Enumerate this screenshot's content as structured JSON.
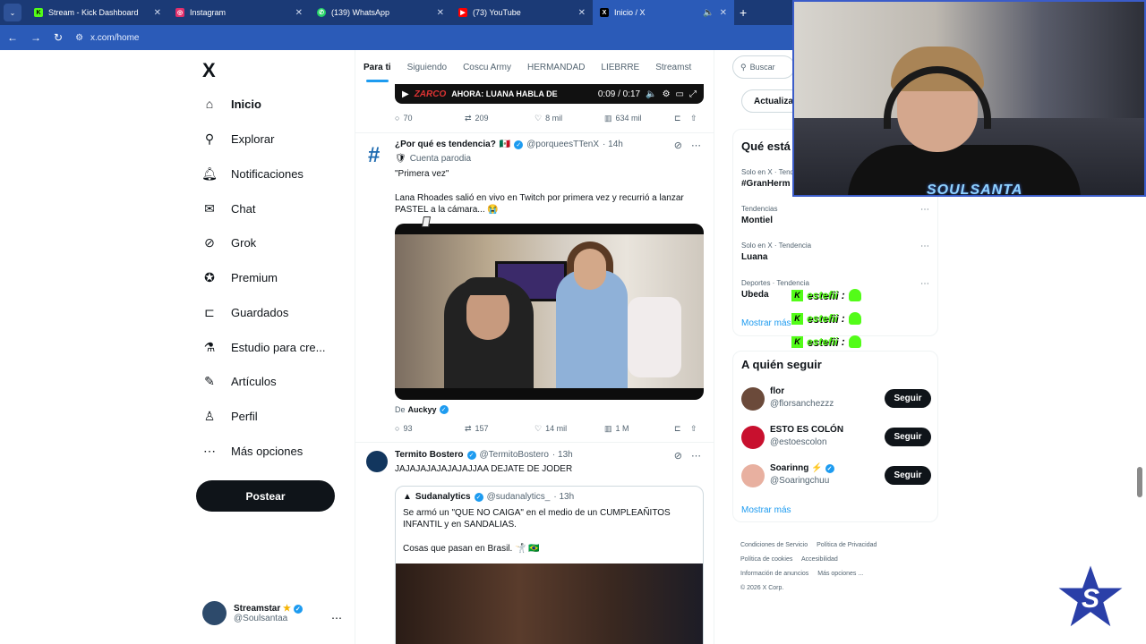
{
  "browser": {
    "tabs": [
      {
        "label": "Stream - Kick Dashboard",
        "icon": "kick-icon",
        "color": "#53fc18"
      },
      {
        "label": "Instagram",
        "icon": "instagram-icon",
        "color": "#e1306c"
      },
      {
        "label": "(139) WhatsApp",
        "icon": "whatsapp-icon",
        "color": "#25d366"
      },
      {
        "label": "(73) YouTube",
        "icon": "youtube-icon",
        "color": "#ff0000"
      },
      {
        "label": "Inicio / X",
        "icon": "x-icon",
        "color": "#000000",
        "active": true
      }
    ],
    "url": "x.com/home"
  },
  "nav": {
    "logo": "X",
    "items": [
      {
        "label": "Inicio",
        "icon": "home-icon",
        "active": true
      },
      {
        "label": "Explorar",
        "icon": "search-icon"
      },
      {
        "label": "Notificaciones",
        "icon": "bell-icon"
      },
      {
        "label": "Chat",
        "icon": "mail-icon"
      },
      {
        "label": "Grok",
        "icon": "grok-icon"
      },
      {
        "label": "Premium",
        "icon": "premium-icon"
      },
      {
        "label": "Guardados",
        "icon": "bookmark-icon"
      },
      {
        "label": "Estudio para cre...",
        "icon": "flask-icon"
      },
      {
        "label": "Artículos",
        "icon": "article-icon"
      },
      {
        "label": "Perfil",
        "icon": "person-icon"
      },
      {
        "label": "Más opciones",
        "icon": "more-circle-icon"
      }
    ],
    "post_label": "Postear",
    "profile": {
      "name": "Streamstar",
      "handle": "@Soulsantaa"
    }
  },
  "feed": {
    "tabs": [
      "Para ti",
      "Siguiendo",
      "Coscu Army",
      "HERMANDAD",
      "LIEBRRE",
      "Streamst"
    ],
    "video_strip": {
      "brand": "ZARCO",
      "title": "AHORA: LUANA HABLA DE",
      "time": "0:09 / 0:17"
    },
    "first_actions": {
      "replies": "70",
      "reposts": "209",
      "likes": "8 mil",
      "views": "634 mil"
    },
    "tweet2": {
      "name": "¿Por qué es tendencia?",
      "flag": "🇲🇽",
      "handle": "@porqueesTTenX",
      "time": "· 14h",
      "badge": "Cuenta parodia",
      "text1": "\"Primera vez\"",
      "text2": "Lana Rhoades salió en vivo en Twitch por primera vez y recurrió a lanzar PASTEL a la cámara... 😭",
      "credit_prefix": "De",
      "credit_name": "Auckyy",
      "replies": "93",
      "reposts": "157",
      "likes": "14 mil",
      "views": "1 M"
    },
    "tweet3": {
      "name": "Termito Bostero",
      "handle": "@TermitoBostero",
      "time": "· 13h",
      "text": "JAJAJAJAJAJAJAJJAA DEJATE DE JODER",
      "quote": {
        "name": "Sudanalytics",
        "handle": "@sudanalytics_",
        "time": "· 13h",
        "text1": "Se armó un \"QUE NO CAIGA\" en el medio de un CUMPLEAÑITOS INFANTIL y en SANDALIAS.",
        "text2": "Cosas que pasan en Brasil. 🤺 🇧🇷"
      }
    }
  },
  "sidebar": {
    "search_placeholder": "Buscar",
    "update_label": "Actualiza",
    "trends_title": "Qué está",
    "trends": [
      {
        "context": "Solo en X · Tend",
        "topic": "#GranHerm"
      },
      {
        "context": "Tendencias",
        "topic": "Montiel"
      },
      {
        "context": "Solo en X · Tendencia",
        "topic": "Luana"
      },
      {
        "context": "Deportes · Tendencia",
        "topic": "Ubeda"
      }
    ],
    "show_more": "Mostrar más",
    "follow_title": "A quién seguir",
    "follow": [
      {
        "name": "flor",
        "handle": "@florsanchezzz",
        "button": "Seguir",
        "color": "#6b4a3a"
      },
      {
        "name": "ESTO ES COLÓN",
        "handle": "@estoescolon",
        "button": "Seguir",
        "color": "#c8102e"
      },
      {
        "name": "Soarinng ⚡",
        "handle": "@Soaringchuu",
        "button": "Seguir",
        "color": "#e8b0a0",
        "verified": true
      }
    ],
    "follow_more": "Mostrar más",
    "footer": [
      "Condiciones de Servicio",
      "Política de Privacidad",
      "Política de cookies",
      "Accesibilidad",
      "Información de anuncios",
      "Más opciones ...",
      "© 2026 X Corp."
    ]
  },
  "overlay": {
    "webcam_logo": "SOULSANTA",
    "chat": [
      {
        "user": "estefii",
        "sep": ":"
      },
      {
        "user": "estefii",
        "sep": ":"
      },
      {
        "user": "estefii",
        "sep": ":"
      }
    ]
  }
}
